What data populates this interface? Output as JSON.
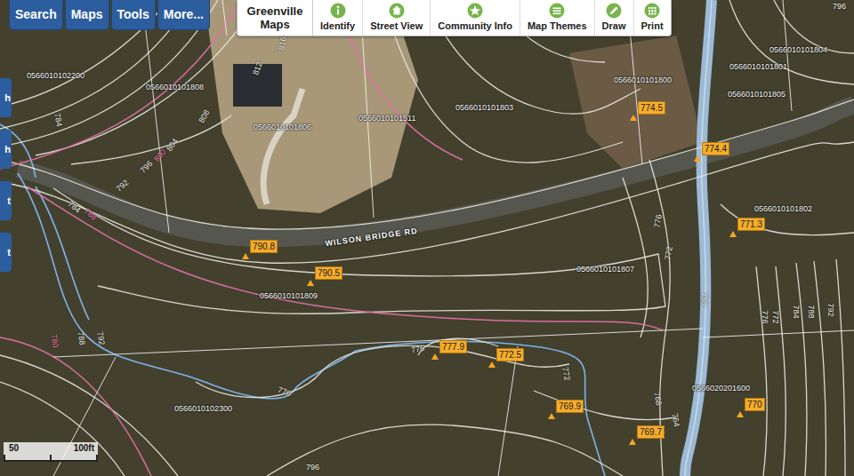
{
  "toolbar": {
    "buttons": [
      "Search",
      "Maps",
      "Tools",
      "More..."
    ]
  },
  "side_tabs": [
    "h",
    "h",
    "t",
    "t"
  ],
  "app_bar": {
    "logo": "Greenville Maps",
    "tools": [
      {
        "label": "Identify",
        "kind": "info"
      },
      {
        "label": "Street View",
        "kind": "street"
      },
      {
        "label": "Community Info",
        "kind": "star"
      },
      {
        "label": "Map Themes",
        "kind": "themes"
      },
      {
        "label": "Draw",
        "kind": "pencil"
      },
      {
        "label": "Print",
        "kind": "grid"
      }
    ]
  },
  "map": {
    "road_label": "WILSON BRIDGE RD",
    "parcels": [
      "0566010102200",
      "0566010101808",
      "0566010101806",
      "0566010101511",
      "0566010101803",
      "0566010101800",
      "0566010101801",
      "0566010101805",
      "0566010101804",
      "0566010101802",
      "0566010101807",
      "0566010101809",
      "0566010102300",
      "0566020201600"
    ],
    "spot_elevations": [
      "774.5",
      "774.4",
      "790.8",
      "790.5",
      "771.3",
      "777.9",
      "772.5",
      "769.9",
      "769.7",
      "770"
    ],
    "contour_labels": [
      {
        "label": "816",
        "kind": "intermediate"
      },
      {
        "label": "812",
        "kind": "intermediate"
      },
      {
        "label": "808",
        "kind": "intermediate"
      },
      {
        "label": "804",
        "kind": "intermediate"
      },
      {
        "label": "800",
        "kind": "index"
      },
      {
        "label": "796",
        "kind": "intermediate"
      },
      {
        "label": "792",
        "kind": "intermediate"
      },
      {
        "label": "784",
        "kind": "intermediate"
      },
      {
        "label": "784",
        "kind": "intermediate"
      },
      {
        "label": "780",
        "kind": "index"
      },
      {
        "label": "788",
        "kind": "intermediate"
      },
      {
        "label": "792",
        "kind": "intermediate"
      },
      {
        "label": "776",
        "kind": "intermediate"
      },
      {
        "label": "776",
        "kind": "intermediate"
      },
      {
        "label": "772",
        "kind": "intermediate"
      },
      {
        "label": "772",
        "kind": "intermediate"
      },
      {
        "label": "776",
        "kind": "intermediate"
      },
      {
        "label": "768",
        "kind": "intermediate"
      },
      {
        "label": "768",
        "kind": "intermediate"
      },
      {
        "label": "764",
        "kind": "intermediate"
      },
      {
        "label": "772",
        "kind": "intermediate"
      },
      {
        "label": "776",
        "kind": "intermediate"
      },
      {
        "label": "784",
        "kind": "intermediate"
      },
      {
        "label": "788",
        "kind": "intermediate"
      },
      {
        "label": "792",
        "kind": "intermediate"
      },
      {
        "label": "796",
        "kind": "intermediate"
      },
      {
        "label": "796",
        "kind": "intermediate"
      },
      {
        "label": "788",
        "kind": "index"
      }
    ]
  },
  "scale_bar": {
    "labels": [
      "50",
      "100ft"
    ]
  }
}
